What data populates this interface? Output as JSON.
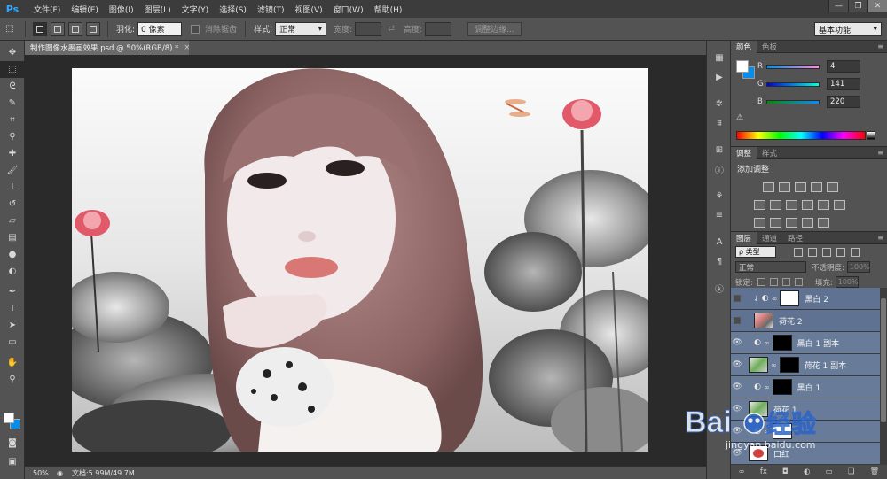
{
  "app": {
    "logo_text": "Ps",
    "menus": [
      "文件(F)",
      "编辑(E)",
      "图像(I)",
      "图层(L)",
      "文字(Y)",
      "选择(S)",
      "滤镜(T)",
      "视图(V)",
      "窗口(W)",
      "帮助(H)"
    ],
    "window_controls": [
      "—",
      "❐",
      "✕"
    ]
  },
  "options": {
    "feather_label": "羽化:",
    "feather_value": "0 像素",
    "antialias_label": "消除锯齿",
    "style_label": "样式:",
    "style_value": "正常",
    "width_label": "宽度:",
    "height_label": "高度:",
    "refine_edge_label": "调整边缘...",
    "workspace_value": "基本功能"
  },
  "document": {
    "tab_title": "制作图像水墨画效果.psd @ 50%(RGB/8) *",
    "zoom": "50%",
    "doc_info": "文档:5.99M/49.7M"
  },
  "color_panel": {
    "tabs": [
      "颜色",
      "色板"
    ],
    "r_label": "R",
    "r_value": "4",
    "g_label": "G",
    "g_value": "141",
    "b_label": "B",
    "b_value": "220",
    "foreground_color": "#ffffff",
    "background_color": "#0a8de8"
  },
  "adjustments_panel": {
    "tabs": [
      "调整",
      "样式"
    ],
    "title": "添加调整"
  },
  "layers_panel": {
    "tabs": [
      "图层",
      "通道",
      "路径"
    ],
    "filter_label": "ρ 类型",
    "blend_mode": "正常",
    "opacity_label": "不透明度:",
    "opacity_value": "100%",
    "lock_label": "锁定:",
    "fill_label": "填充:",
    "fill_value": "100%",
    "layers": [
      {
        "name": "黑白 2",
        "visible": false,
        "type": "adjust-white"
      },
      {
        "name": "荷花 2",
        "visible": false,
        "type": "photo"
      },
      {
        "name": "黑白 1 副本",
        "visible": true,
        "type": "adjust-mask"
      },
      {
        "name": "荷花 1 副本",
        "visible": true,
        "type": "photo-mask"
      },
      {
        "name": "黑白 1",
        "visible": true,
        "type": "adjust-mask"
      },
      {
        "name": "荷花 1",
        "visible": true,
        "type": "photo2"
      },
      {
        "name": "",
        "visible": true,
        "type": "adjust-white"
      },
      {
        "name": "口红",
        "visible": true,
        "type": "lips"
      }
    ],
    "footer_icons": [
      "link-icon",
      "fx-icon",
      "mask-icon",
      "adjust-icon",
      "folder-icon",
      "new-layer-icon",
      "trash-icon"
    ],
    "footer_fx": "fx"
  },
  "watermark": {
    "brand": "Bai",
    "brand_suffix": "经验",
    "url": "jingyan.baidu.com"
  }
}
